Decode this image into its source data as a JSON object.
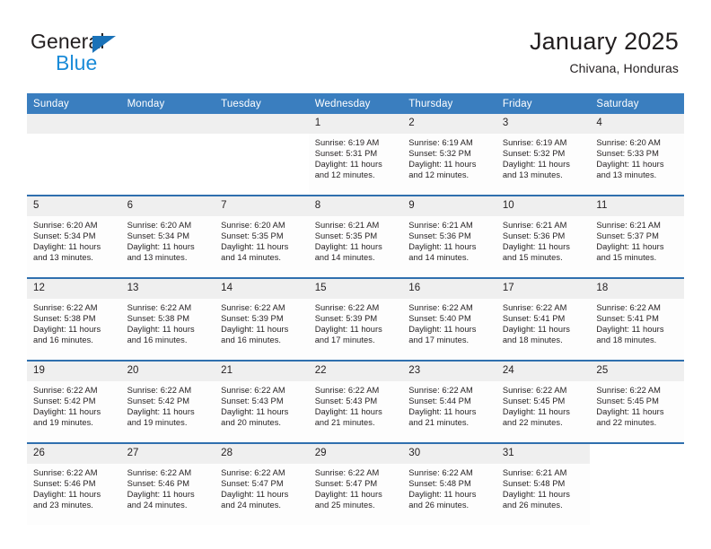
{
  "brand": {
    "name_part1": "General",
    "name_part2": "Blue",
    "triangle_color": "#1a72b8",
    "blue_text_color": "#1a8bd8"
  },
  "header": {
    "title": "January 2025",
    "subtitle": "Chivana, Honduras"
  },
  "theme": {
    "header_blue": "#3a7ebf",
    "row_divider_blue": "#2f6fae",
    "daynum_band": "#efefef"
  },
  "weekday_headers": [
    "Sunday",
    "Monday",
    "Tuesday",
    "Wednesday",
    "Thursday",
    "Friday",
    "Saturday"
  ],
  "labels": {
    "sunrise_prefix": "Sunrise:",
    "sunset_prefix": "Sunset:",
    "daylight_prefix": "Daylight:"
  },
  "weeks": [
    [
      {
        "blank": true
      },
      {
        "blank": true
      },
      {
        "blank": true
      },
      {
        "day": "1",
        "sunrise": "Sunrise: 6:19 AM",
        "sunset": "Sunset: 5:31 PM",
        "daylight_line1": "Daylight: 11 hours",
        "daylight_line2": "and 12 minutes."
      },
      {
        "day": "2",
        "sunrise": "Sunrise: 6:19 AM",
        "sunset": "Sunset: 5:32 PM",
        "daylight_line1": "Daylight: 11 hours",
        "daylight_line2": "and 12 minutes."
      },
      {
        "day": "3",
        "sunrise": "Sunrise: 6:19 AM",
        "sunset": "Sunset: 5:32 PM",
        "daylight_line1": "Daylight: 11 hours",
        "daylight_line2": "and 13 minutes."
      },
      {
        "day": "4",
        "sunrise": "Sunrise: 6:20 AM",
        "sunset": "Sunset: 5:33 PM",
        "daylight_line1": "Daylight: 11 hours",
        "daylight_line2": "and 13 minutes."
      }
    ],
    [
      {
        "day": "5",
        "sunrise": "Sunrise: 6:20 AM",
        "sunset": "Sunset: 5:34 PM",
        "daylight_line1": "Daylight: 11 hours",
        "daylight_line2": "and 13 minutes."
      },
      {
        "day": "6",
        "sunrise": "Sunrise: 6:20 AM",
        "sunset": "Sunset: 5:34 PM",
        "daylight_line1": "Daylight: 11 hours",
        "daylight_line2": "and 13 minutes."
      },
      {
        "day": "7",
        "sunrise": "Sunrise: 6:20 AM",
        "sunset": "Sunset: 5:35 PM",
        "daylight_line1": "Daylight: 11 hours",
        "daylight_line2": "and 14 minutes."
      },
      {
        "day": "8",
        "sunrise": "Sunrise: 6:21 AM",
        "sunset": "Sunset: 5:35 PM",
        "daylight_line1": "Daylight: 11 hours",
        "daylight_line2": "and 14 minutes."
      },
      {
        "day": "9",
        "sunrise": "Sunrise: 6:21 AM",
        "sunset": "Sunset: 5:36 PM",
        "daylight_line1": "Daylight: 11 hours",
        "daylight_line2": "and 14 minutes."
      },
      {
        "day": "10",
        "sunrise": "Sunrise: 6:21 AM",
        "sunset": "Sunset: 5:36 PM",
        "daylight_line1": "Daylight: 11 hours",
        "daylight_line2": "and 15 minutes."
      },
      {
        "day": "11",
        "sunrise": "Sunrise: 6:21 AM",
        "sunset": "Sunset: 5:37 PM",
        "daylight_line1": "Daylight: 11 hours",
        "daylight_line2": "and 15 minutes."
      }
    ],
    [
      {
        "day": "12",
        "sunrise": "Sunrise: 6:22 AM",
        "sunset": "Sunset: 5:38 PM",
        "daylight_line1": "Daylight: 11 hours",
        "daylight_line2": "and 16 minutes."
      },
      {
        "day": "13",
        "sunrise": "Sunrise: 6:22 AM",
        "sunset": "Sunset: 5:38 PM",
        "daylight_line1": "Daylight: 11 hours",
        "daylight_line2": "and 16 minutes."
      },
      {
        "day": "14",
        "sunrise": "Sunrise: 6:22 AM",
        "sunset": "Sunset: 5:39 PM",
        "daylight_line1": "Daylight: 11 hours",
        "daylight_line2": "and 16 minutes."
      },
      {
        "day": "15",
        "sunrise": "Sunrise: 6:22 AM",
        "sunset": "Sunset: 5:39 PM",
        "daylight_line1": "Daylight: 11 hours",
        "daylight_line2": "and 17 minutes."
      },
      {
        "day": "16",
        "sunrise": "Sunrise: 6:22 AM",
        "sunset": "Sunset: 5:40 PM",
        "daylight_line1": "Daylight: 11 hours",
        "daylight_line2": "and 17 minutes."
      },
      {
        "day": "17",
        "sunrise": "Sunrise: 6:22 AM",
        "sunset": "Sunset: 5:41 PM",
        "daylight_line1": "Daylight: 11 hours",
        "daylight_line2": "and 18 minutes."
      },
      {
        "day": "18",
        "sunrise": "Sunrise: 6:22 AM",
        "sunset": "Sunset: 5:41 PM",
        "daylight_line1": "Daylight: 11 hours",
        "daylight_line2": "and 18 minutes."
      }
    ],
    [
      {
        "day": "19",
        "sunrise": "Sunrise: 6:22 AM",
        "sunset": "Sunset: 5:42 PM",
        "daylight_line1": "Daylight: 11 hours",
        "daylight_line2": "and 19 minutes."
      },
      {
        "day": "20",
        "sunrise": "Sunrise: 6:22 AM",
        "sunset": "Sunset: 5:42 PM",
        "daylight_line1": "Daylight: 11 hours",
        "daylight_line2": "and 19 minutes."
      },
      {
        "day": "21",
        "sunrise": "Sunrise: 6:22 AM",
        "sunset": "Sunset: 5:43 PM",
        "daylight_line1": "Daylight: 11 hours",
        "daylight_line2": "and 20 minutes."
      },
      {
        "day": "22",
        "sunrise": "Sunrise: 6:22 AM",
        "sunset": "Sunset: 5:43 PM",
        "daylight_line1": "Daylight: 11 hours",
        "daylight_line2": "and 21 minutes."
      },
      {
        "day": "23",
        "sunrise": "Sunrise: 6:22 AM",
        "sunset": "Sunset: 5:44 PM",
        "daylight_line1": "Daylight: 11 hours",
        "daylight_line2": "and 21 minutes."
      },
      {
        "day": "24",
        "sunrise": "Sunrise: 6:22 AM",
        "sunset": "Sunset: 5:45 PM",
        "daylight_line1": "Daylight: 11 hours",
        "daylight_line2": "and 22 minutes."
      },
      {
        "day": "25",
        "sunrise": "Sunrise: 6:22 AM",
        "sunset": "Sunset: 5:45 PM",
        "daylight_line1": "Daylight: 11 hours",
        "daylight_line2": "and 22 minutes."
      }
    ],
    [
      {
        "day": "26",
        "sunrise": "Sunrise: 6:22 AM",
        "sunset": "Sunset: 5:46 PM",
        "daylight_line1": "Daylight: 11 hours",
        "daylight_line2": "and 23 minutes."
      },
      {
        "day": "27",
        "sunrise": "Sunrise: 6:22 AM",
        "sunset": "Sunset: 5:46 PM",
        "daylight_line1": "Daylight: 11 hours",
        "daylight_line2": "and 24 minutes."
      },
      {
        "day": "28",
        "sunrise": "Sunrise: 6:22 AM",
        "sunset": "Sunset: 5:47 PM",
        "daylight_line1": "Daylight: 11 hours",
        "daylight_line2": "and 24 minutes."
      },
      {
        "day": "29",
        "sunrise": "Sunrise: 6:22 AM",
        "sunset": "Sunset: 5:47 PM",
        "daylight_line1": "Daylight: 11 hours",
        "daylight_line2": "and 25 minutes."
      },
      {
        "day": "30",
        "sunrise": "Sunrise: 6:22 AM",
        "sunset": "Sunset: 5:48 PM",
        "daylight_line1": "Daylight: 11 hours",
        "daylight_line2": "and 26 minutes."
      },
      {
        "day": "31",
        "sunrise": "Sunrise: 6:21 AM",
        "sunset": "Sunset: 5:48 PM",
        "daylight_line1": "Daylight: 11 hours",
        "daylight_line2": "and 26 minutes."
      },
      {
        "blank": true,
        "lastcol": true
      }
    ]
  ]
}
